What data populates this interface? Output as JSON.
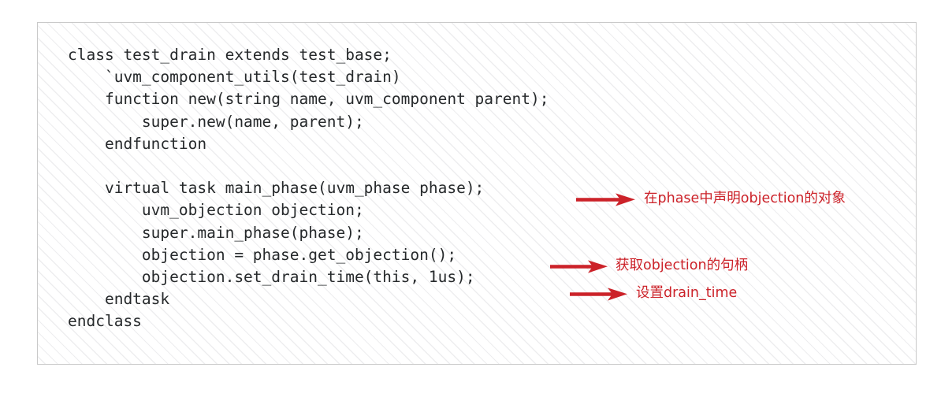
{
  "figure": {
    "kind": "annotated-code-snippet",
    "language": "SystemVerilog / UVM",
    "accent_color": "#cc2229",
    "code_color": "#26292b",
    "border_color": "#c9c9c9",
    "background": "#ffffff"
  },
  "code": {
    "text": "class test_drain extends test_base;\n    `uvm_component_utils(test_drain)\n    function new(string name, uvm_component parent);\n        super.new(name, parent);\n    endfunction\n\n    virtual task main_phase(uvm_phase phase);\n        uvm_objection objection;\n        super.main_phase(phase);\n        objection = phase.get_objection();\n        objection.set_drain_time(this, 1us);\n    endtask\nendclass",
    "lines": [
      "class test_drain extends test_base;",
      "    `uvm_component_utils(test_drain)",
      "    function new(string name, uvm_component parent);",
      "        super.new(name, parent);",
      "    endfunction",
      "",
      "    virtual task main_phase(uvm_phase phase);",
      "        uvm_objection objection;",
      "        super.main_phase(phase);",
      "        objection = phase.get_objection();",
      "        objection.set_drain_time(this, 1us);",
      "    endtask",
      "endclass"
    ]
  },
  "annotations": [
    {
      "id": "ann-0",
      "text": "在phase中声明objection的对象",
      "targets_line": "    virtual task main_phase(uvm_phase phase);",
      "color": "#cc2229"
    },
    {
      "id": "ann-1",
      "text": "获取objection的句柄",
      "targets_line": "        objection = phase.get_objection();",
      "color": "#cc2229"
    },
    {
      "id": "ann-2",
      "text": "设置drain_time",
      "targets_line": "        objection.set_drain_time(this, 1us);",
      "color": "#cc2229"
    }
  ]
}
